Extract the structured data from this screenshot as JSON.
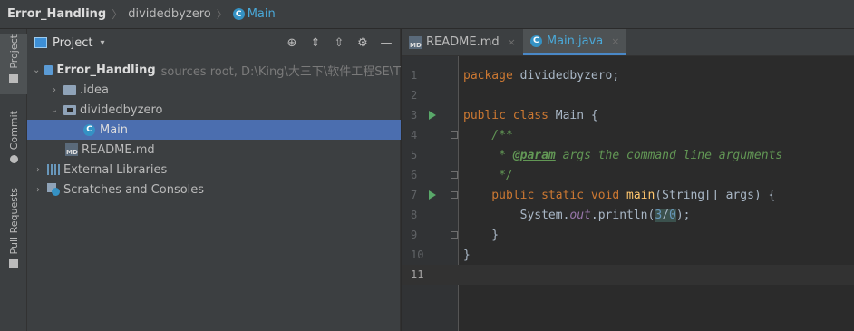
{
  "breadcrumb": {
    "project": "Error_Handling",
    "package": "dividedbyzero",
    "class": "Main",
    "class_icon_letter": "C"
  },
  "tool_strip": {
    "tabs": [
      "Project",
      "Commit",
      "Pull Requests"
    ]
  },
  "project_panel": {
    "title": "Project",
    "dropdown": "▾",
    "tools": [
      "⊕",
      "⇕",
      "⇳",
      "⚙",
      "—"
    ],
    "tree": [
      {
        "label": "Error_Handling",
        "extra": "sources root,  D:\\King\\大三下\\软件工程SE\\T",
        "chevron": "⌄"
      },
      {
        "label": ".idea",
        "chevron": "›"
      },
      {
        "label": "dividedbyzero",
        "chevron": "⌄"
      },
      {
        "label": "Main",
        "icon_letter": "C"
      },
      {
        "label": "README.md",
        "icon_text": "MD"
      },
      {
        "label": "External Libraries",
        "chevron": "›"
      },
      {
        "label": "Scratches and Consoles",
        "chevron": "›"
      }
    ]
  },
  "editor": {
    "tabs": [
      {
        "label": "README.md",
        "icon_text": "MD",
        "close": "×"
      },
      {
        "label": "Main.java",
        "icon_letter": "C",
        "close": "×"
      }
    ],
    "line_numbers": [
      "1",
      "2",
      "3",
      "4",
      "5",
      "6",
      "7",
      "8",
      "9",
      "10",
      "11"
    ],
    "code": {
      "l1_kw": "package",
      "l1_rest": " dividedbyzero;",
      "l3_kw": "public class",
      "l3_rest": " Main {",
      "l4": "    /**",
      "l5_pre": "     * ",
      "l5_tag": "@param",
      "l5_rest": " args the command line arguments",
      "l6": "     */",
      "l7_kw": "    public static void",
      "l7_fn": " main",
      "l7_rest": "(String[] args) {",
      "l8_pre": "        System.",
      "l8_st": "out",
      "l8_mid": ".println(",
      "l8_num1": "3",
      "l8_op": "/",
      "l8_num2": "0",
      "l8_end": ");",
      "l9": "    }",
      "l10": "}"
    }
  },
  "colors": {
    "accent": "#4a88c7",
    "selection": "#4b6eaf",
    "run": "#59a869"
  }
}
